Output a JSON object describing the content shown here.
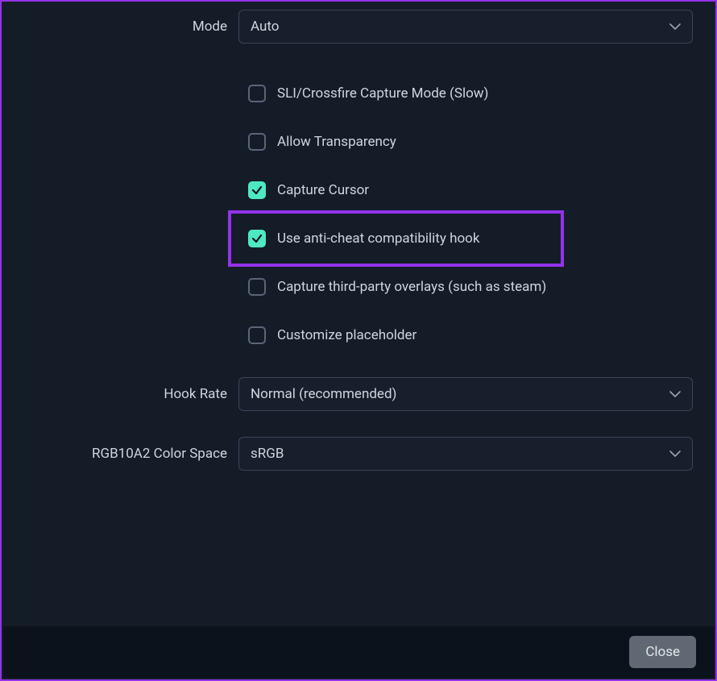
{
  "mode": {
    "label": "Mode",
    "value": "Auto"
  },
  "checkboxes": {
    "sli_crossfire": {
      "label": "SLI/Crossfire Capture Mode (Slow)",
      "checked": false
    },
    "allow_transparency": {
      "label": "Allow Transparency",
      "checked": false
    },
    "capture_cursor": {
      "label": "Capture Cursor",
      "checked": true
    },
    "anticheat_hook": {
      "label": "Use anti-cheat compatibility hook",
      "checked": true,
      "highlighted": true
    },
    "third_party_overlays": {
      "label": "Capture third-party overlays (such as steam)",
      "checked": false
    },
    "customize_placeholder": {
      "label": "Customize placeholder",
      "checked": false
    }
  },
  "hook_rate": {
    "label": "Hook Rate",
    "value": "Normal (recommended)"
  },
  "color_space": {
    "label": "RGB10A2 Color Space",
    "value": "sRGB"
  },
  "footer": {
    "close_label": "Close"
  },
  "colors": {
    "accent_highlight": "#9333ea",
    "checkbox_checked": "#4ee8c2",
    "bg": "#141c28",
    "footer_bg": "#0c121c"
  }
}
